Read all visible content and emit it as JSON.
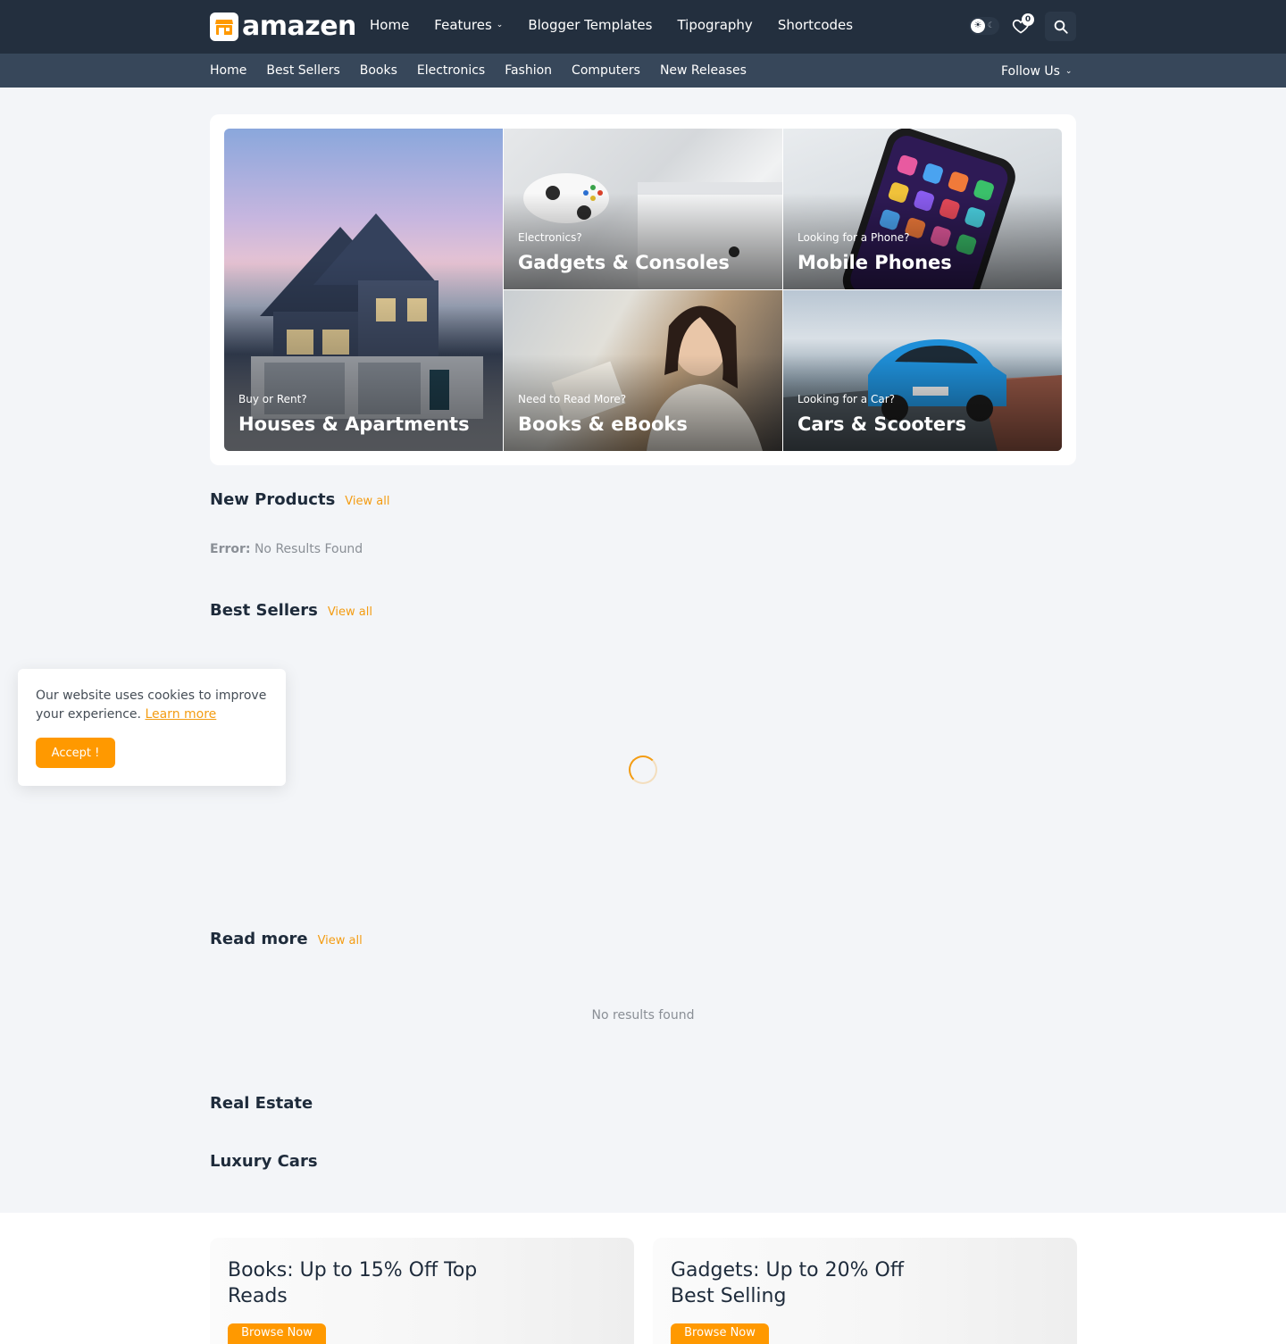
{
  "brand": {
    "name": "amazen",
    "accent": "#ff9900",
    "link_color": "#f39c12",
    "header_bg": "#232f3e",
    "subnav_bg": "#37475a"
  },
  "main_nav": [
    {
      "label": "Home"
    },
    {
      "label": "Features",
      "has_dropdown": true
    },
    {
      "label": "Blogger Templates"
    },
    {
      "label": "Tipography"
    },
    {
      "label": "Shortcodes"
    }
  ],
  "header_actions": {
    "theme_toggle_icon": "sun-moon-icon",
    "wishlist_icon": "heart-icon",
    "wishlist_count": "0",
    "search_icon": "search-icon"
  },
  "sub_nav": [
    "Home",
    "Best Sellers",
    "Books",
    "Electronics",
    "Fashion",
    "Computers",
    "New Releases"
  ],
  "follow": {
    "label": "Follow Us"
  },
  "hero": [
    {
      "kicker": "Buy or Rent?",
      "title": "Houses & Apartments"
    },
    {
      "kicker": "Electronics?",
      "title": "Gadgets & Consoles"
    },
    {
      "kicker": "Looking for a Phone?",
      "title": "Mobile Phones"
    },
    {
      "kicker": "Need to Read More?",
      "title": "Books & eBooks"
    },
    {
      "kicker": "Looking for a Car?",
      "title": "Cars & Scooters"
    }
  ],
  "sections": {
    "new_products": {
      "title": "New Products",
      "view_all": "View all",
      "error_label": "Error:",
      "error_text": "No Results Found"
    },
    "best_sellers": {
      "title": "Best Sellers",
      "view_all": "View all"
    },
    "read_more": {
      "title": "Read more",
      "view_all": "View all",
      "empty": "No results found"
    },
    "real_estate": {
      "title": "Real Estate"
    },
    "luxury_cars": {
      "title": "Luxury Cars"
    }
  },
  "cookie": {
    "text": "Our website uses cookies to improve your experience.",
    "link": "Learn more",
    "button": "Accept !"
  },
  "promos": [
    {
      "title": "Books: Up to 15% Off Top Reads",
      "button": "Browse Now"
    },
    {
      "title": "Gadgets: Up to 20% Off Best Selling",
      "button": "Browse Now"
    }
  ]
}
